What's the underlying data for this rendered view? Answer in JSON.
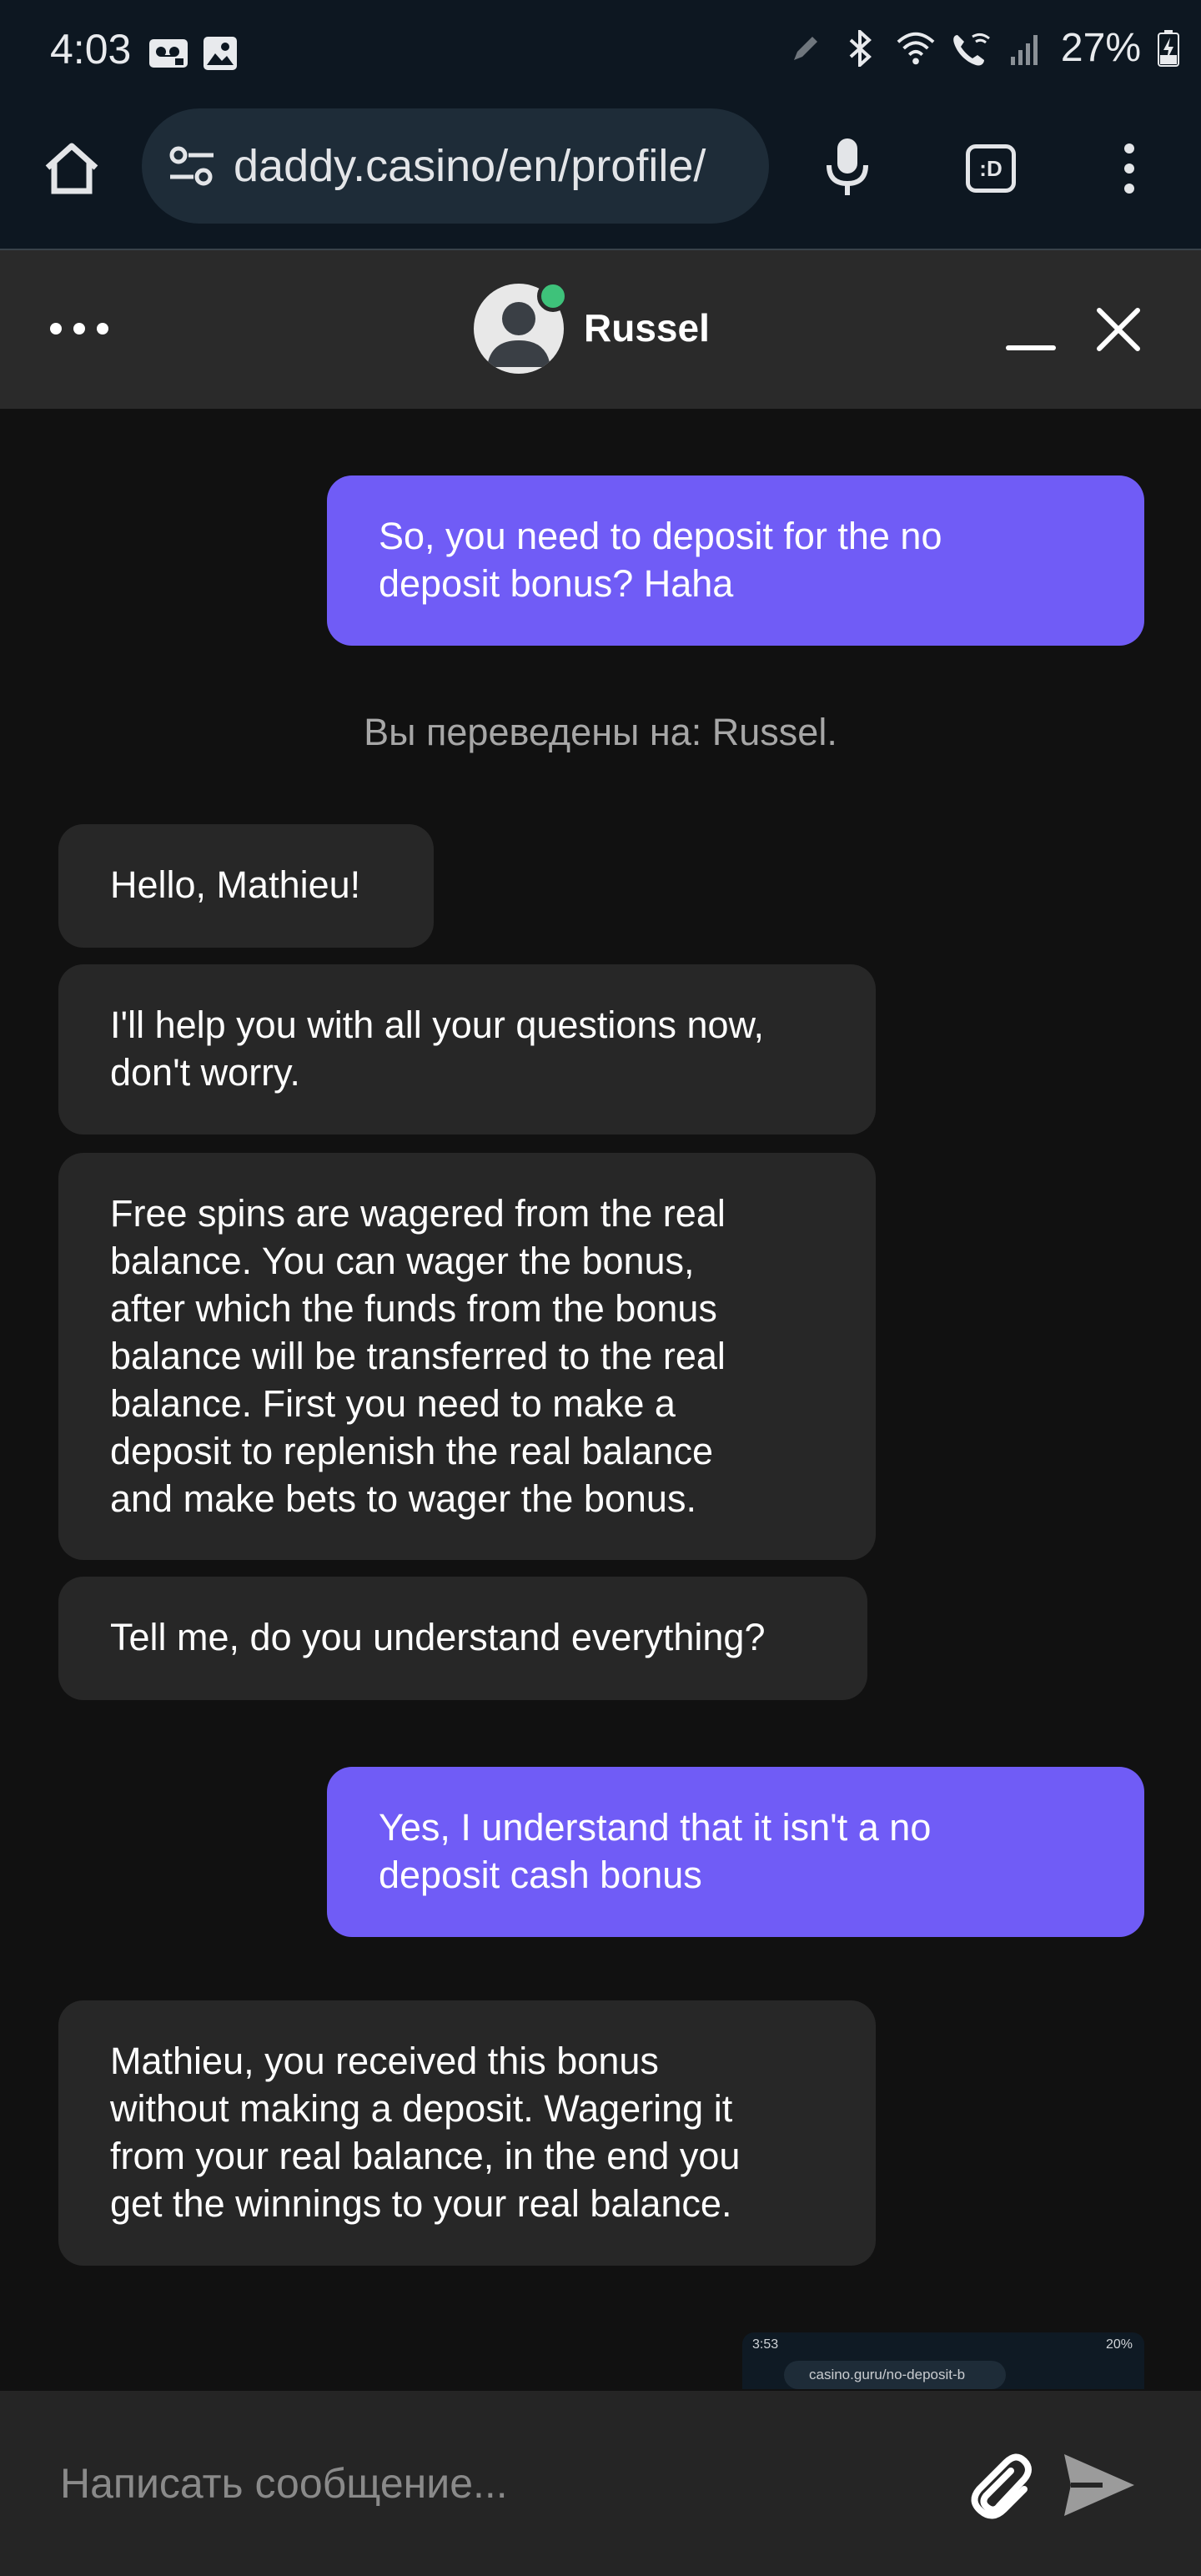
{
  "status_bar": {
    "time": "4:03",
    "battery": "27%",
    "icons": [
      "voicemail-icon",
      "image-icon",
      "pen-icon",
      "bluetooth-icon",
      "wifi-icon",
      "wifi-call-icon",
      "signal-icon",
      "battery-charging-icon"
    ]
  },
  "browser": {
    "url": "daddy.casino/en/profile/",
    "tab_icon_text": ":D",
    "icons": [
      "home-icon",
      "tune-icon",
      "mic-icon",
      "tab-switcher-icon",
      "more-vert-icon"
    ]
  },
  "chat_header": {
    "agent_name": "Russel",
    "status_color": "#3ec27a"
  },
  "messages": [
    {
      "from": "user",
      "lines": [
        "So, you need to deposit for the no",
        "deposit bonus? Haha"
      ]
    },
    {
      "from": "system",
      "text": "Вы переведены на: Russel."
    },
    {
      "from": "agent",
      "lines": [
        "Hello, Mathieu!"
      ]
    },
    {
      "from": "agent",
      "lines": [
        "I'll help you with all your questions now,",
        "don't worry."
      ]
    },
    {
      "from": "agent",
      "lines": [
        "Free spins are wagered from the real",
        "balance. You can wager the bonus,",
        "after which the funds from the bonus",
        "balance will be transferred to the real",
        "balance. First you need to make a",
        "deposit to replenish the real balance",
        "and make bets to wager the bonus."
      ]
    },
    {
      "from": "agent",
      "lines": [
        "Tell me, do you understand everything?"
      ]
    },
    {
      "from": "user",
      "lines": [
        "Yes, I understand that it isn't a no",
        "deposit cash bonus"
      ]
    },
    {
      "from": "agent",
      "lines": [
        "Mathieu, you received this bonus",
        "without making a deposit. Wagering it",
        "from your real balance, in the end you",
        "get the winnings to your real balance."
      ]
    }
  ],
  "attachment_thumbnail": {
    "time": "3:53",
    "battery": "20%",
    "url": "casino.guru/no-deposit-b"
  },
  "composer": {
    "placeholder": "Написать сообщение..."
  },
  "colors": {
    "user_bubble": "#705cf6",
    "agent_bubble": "#272727",
    "background": "#111111",
    "header": "#2a2a2a"
  }
}
